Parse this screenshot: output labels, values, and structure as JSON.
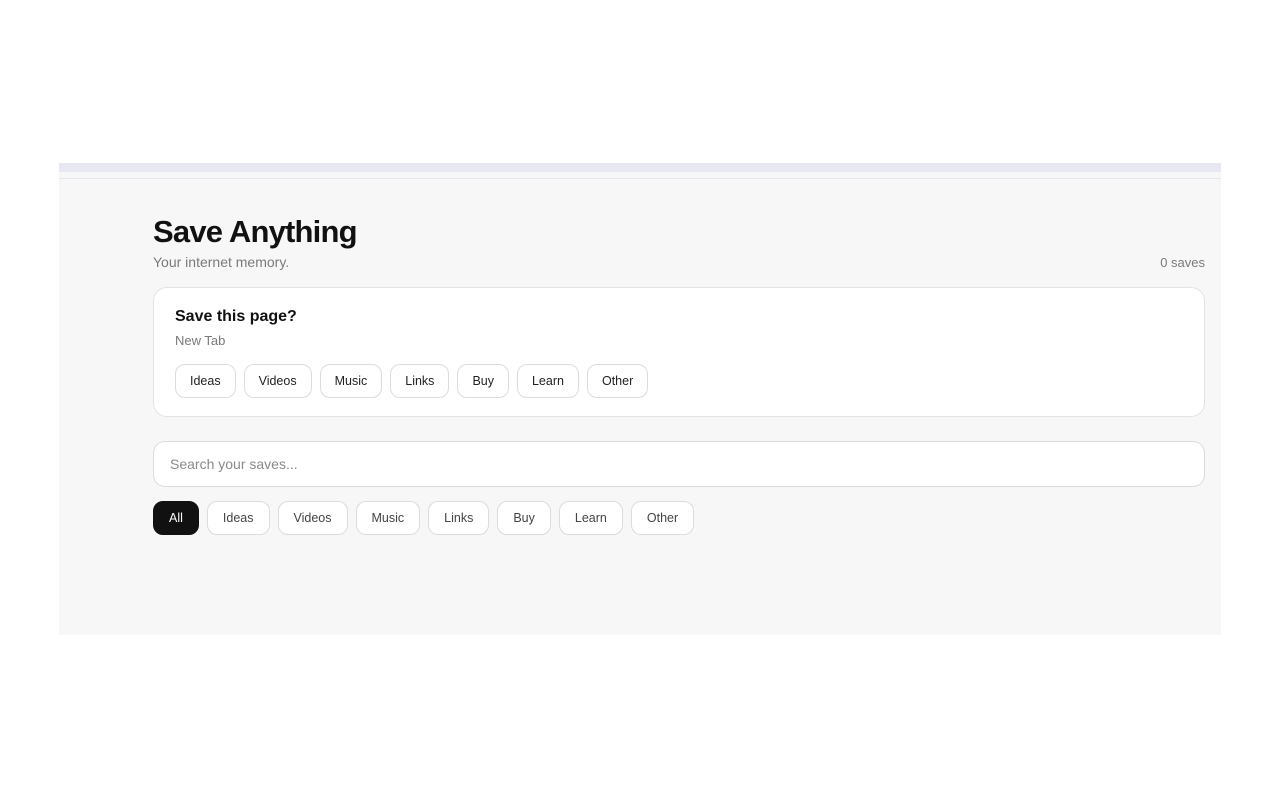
{
  "header": {
    "title": "Save Anything",
    "subtitle": "Your internet memory.",
    "save_count": "0 saves"
  },
  "save_prompt": {
    "title": "Save this page?",
    "page_title": "New Tab",
    "categories": [
      "Ideas",
      "Videos",
      "Music",
      "Links",
      "Buy",
      "Learn",
      "Other"
    ]
  },
  "search": {
    "placeholder": "Search your saves..."
  },
  "filters": {
    "selected": "All",
    "items": [
      "All",
      "Ideas",
      "Videos",
      "Music",
      "Links",
      "Buy",
      "Learn",
      "Other"
    ]
  },
  "colors": {
    "background": "#f7f7f7",
    "accent_active": "#111111",
    "top_bar": "#e8e8f3"
  }
}
